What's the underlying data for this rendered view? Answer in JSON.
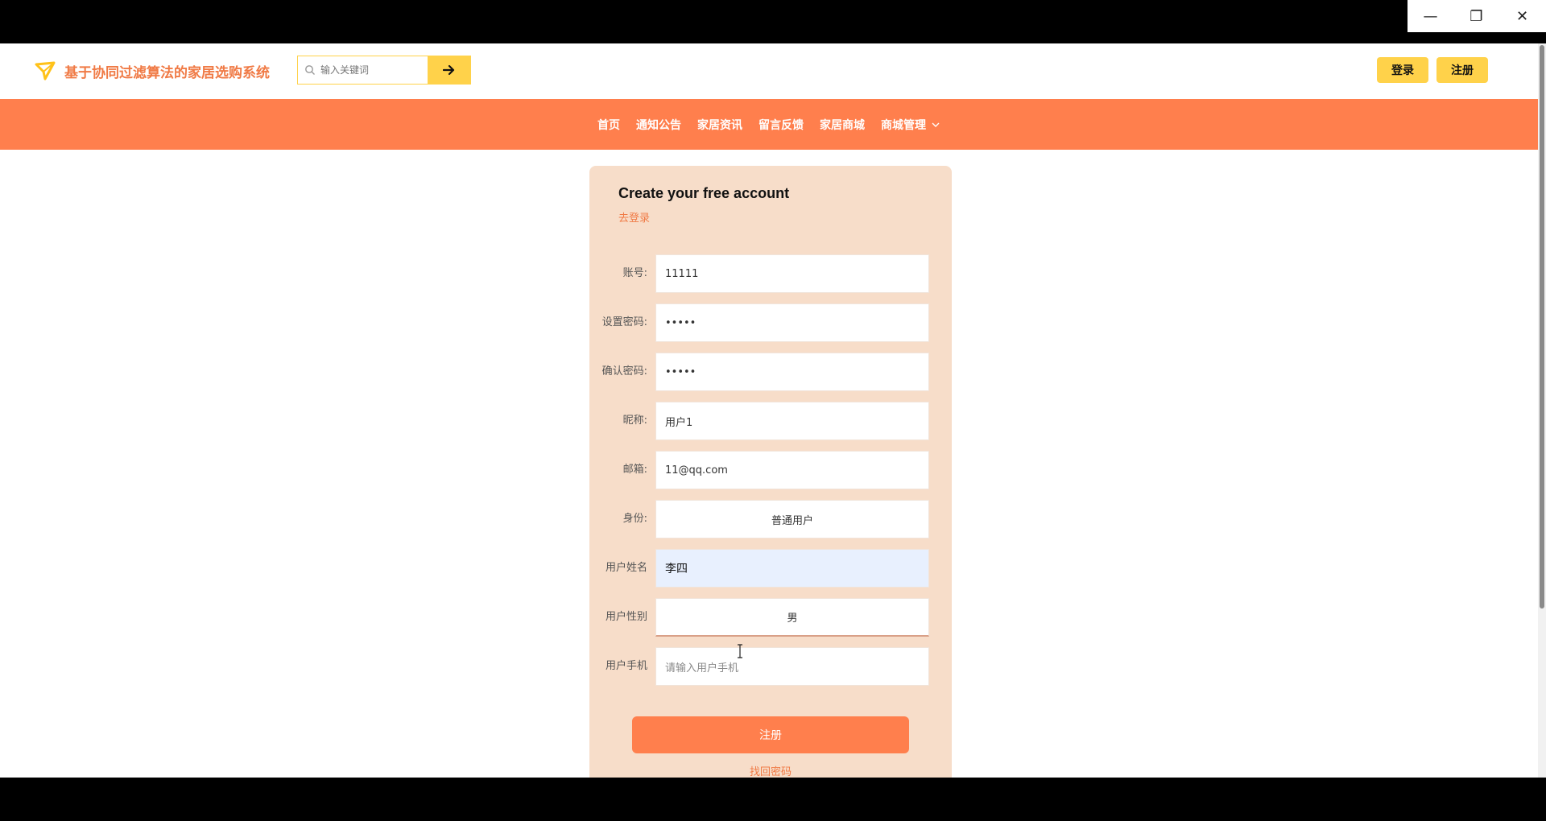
{
  "window": {
    "minimize_glyph": "—",
    "restore_glyph": "❐",
    "close_glyph": "✕"
  },
  "header": {
    "site_title": "基于协同过滤算法的家居选购系统",
    "search_placeholder": "输入关键词",
    "login_label": "登录",
    "register_label": "注册"
  },
  "nav": {
    "items": [
      "首页",
      "通知公告",
      "家居资讯",
      "留言反馈",
      "家居商城",
      "商城管理"
    ]
  },
  "form": {
    "title": "Create your free account",
    "goto_login": "去登录",
    "fields": [
      {
        "label": "账号:",
        "value": "11111"
      },
      {
        "label": "设置密码:",
        "value": "•••••"
      },
      {
        "label": "确认密码:",
        "value": "•••••"
      },
      {
        "label": "昵称:",
        "value": "用户1"
      },
      {
        "label": "邮箱:",
        "value": "11@qq.com"
      },
      {
        "label": "身份:",
        "value": "普通用户"
      },
      {
        "label": "用户姓名",
        "value": "李四"
      },
      {
        "label": "用户性别",
        "value": "男"
      },
      {
        "label": "用户手机",
        "placeholder": "请输入用户手机"
      }
    ],
    "submit_label": "注册",
    "forgot_label": "找回密码"
  },
  "colors": {
    "brand_orange": "#ff7f4d",
    "accent_yellow": "#ffd24a",
    "card_bg": "#f7ddc9"
  }
}
